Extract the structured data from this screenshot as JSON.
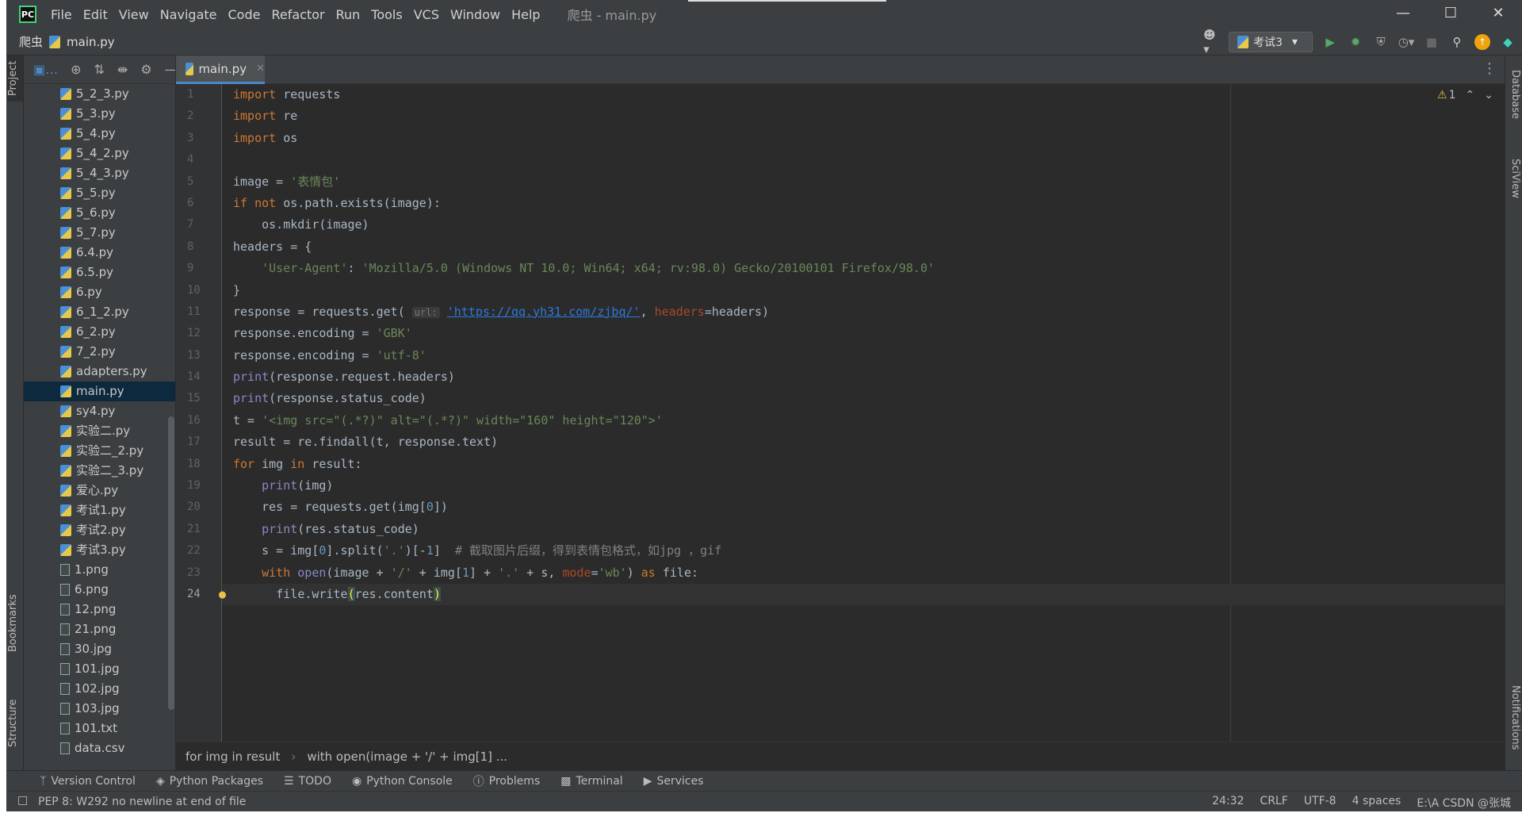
{
  "titlebar": {
    "menu": [
      "File",
      "Edit",
      "View",
      "Navigate",
      "Code",
      "Refactor",
      "Run",
      "Tools",
      "VCS",
      "Window",
      "Help"
    ],
    "window_title": "爬虫 - main.py"
  },
  "navbar": {
    "project": "爬虫",
    "file": "main.py",
    "run_config": "考试3"
  },
  "left_stripe": {
    "project": "Project",
    "bookmarks": "Bookmarks",
    "structure": "Structure"
  },
  "right_stripe": {
    "database": "Database",
    "sciview": "SciView",
    "notifications": "Notifications"
  },
  "project_tree": {
    "items": [
      "5_2_3.py",
      "5_3.py",
      "5_4.py",
      "5_4_2.py",
      "5_4_3.py",
      "5_5.py",
      "5_6.py",
      "5_7.py",
      "6.4.py",
      "6.5.py",
      "6.py",
      "6_1_2.py",
      "6_2.py",
      "7_2.py",
      "adapters.py",
      "main.py",
      "sy4.py",
      "实验二.py",
      "实验二_2.py",
      "实验二_3.py",
      "爱心.py",
      "考试1.py",
      "考试2.py",
      "考试3.py",
      "1.png",
      "6.png",
      "12.png",
      "21.png",
      "30.jpg",
      "101.jpg",
      "102.jpg",
      "103.jpg",
      "101.txt",
      "data.csv"
    ],
    "selected": "main.py"
  },
  "editor": {
    "tab": "main.py",
    "warnings": "1",
    "line_count": 24,
    "current_line": 24,
    "url_hint": "url:",
    "url": "'https://qq.yh31.com/zjbq/'",
    "breadcrumb": [
      "for img in result",
      "with open(image + '/' + img[1] ..."
    ]
  },
  "bottom_tools": [
    "Version Control",
    "Python Packages",
    "TODO",
    "Python Console",
    "Problems",
    "Terminal",
    "Services"
  ],
  "status": {
    "message": "PEP 8: W292 no newline at end of file",
    "position": "24:32",
    "line_sep": "CRLF",
    "encoding": "UTF-8",
    "indent": "4 spaces",
    "path": "E:\\A CSDN @张城"
  }
}
